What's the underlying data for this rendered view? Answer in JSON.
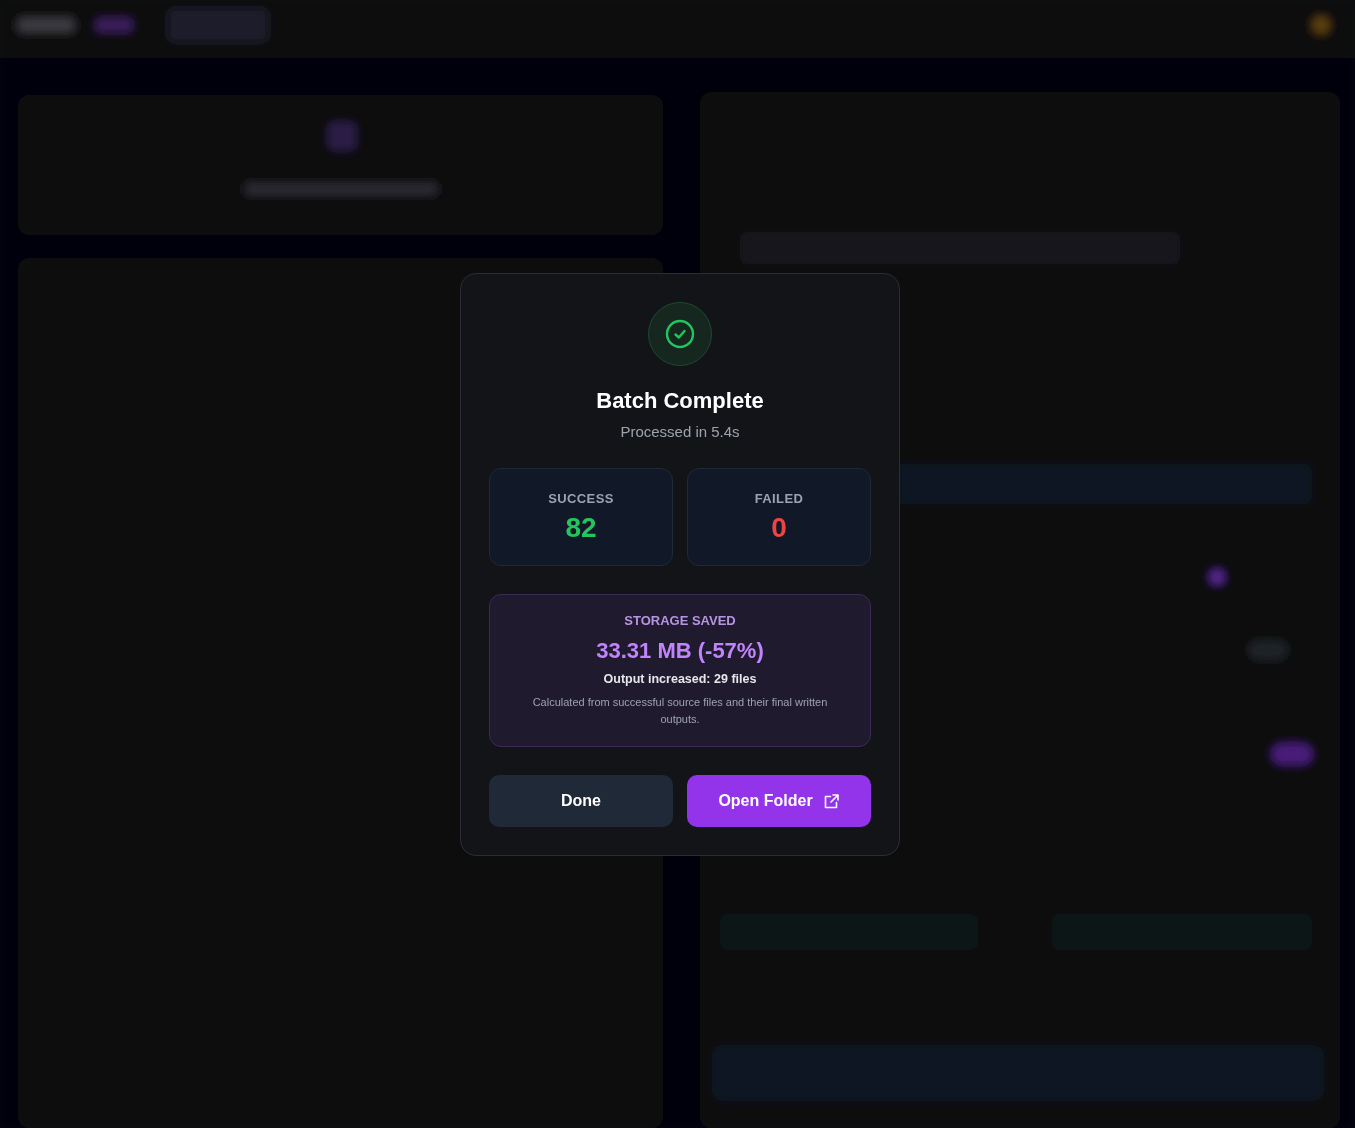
{
  "dialog": {
    "title": "Batch Complete",
    "subtitle": "Processed in 5.4s",
    "stats": [
      {
        "kind": "success",
        "label": "SUCCESS",
        "value": "82"
      },
      {
        "kind": "failed",
        "label": "FAILED",
        "value": "0"
      }
    ],
    "storage": {
      "label": "STORAGE SAVED",
      "value": "33.31 MB (-57%)",
      "detail": "Output increased: 29 files",
      "note": "Calculated from successful source files and their final written outputs."
    },
    "buttons": [
      {
        "kind": "secondary",
        "label": "Done"
      },
      {
        "kind": "primary",
        "label": "Open Folder"
      }
    ]
  }
}
